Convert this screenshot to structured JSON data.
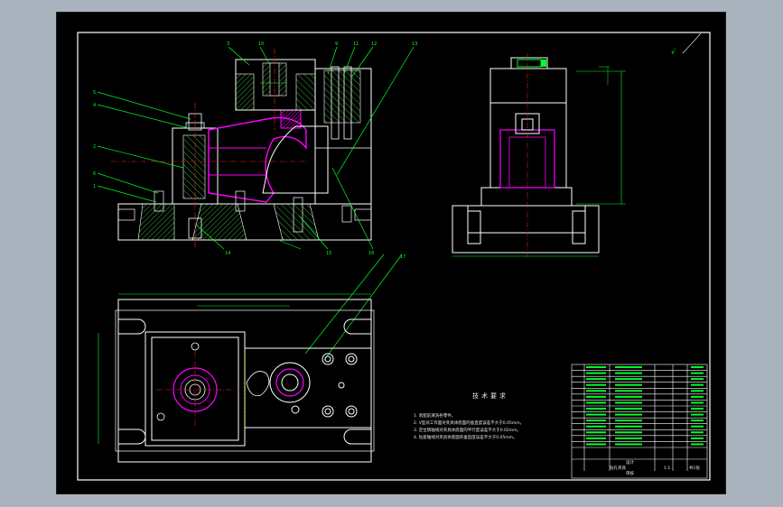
{
  "drawing": {
    "rough_mark": "√",
    "tech_title": "技术要求",
    "tech_notes": [
      "1. 装配前清洗各零件。",
      "2. V型块工作面对夹具体底面的垂直度误差不大于0.05mm。",
      "3. 定位销轴线对夹具体底面的平行度误差不大于0.02mm。",
      "4. 钻套轴线对夹具体底面的垂直度误差不大于0.05mm。"
    ],
    "parts_rows": 14,
    "title_block": {
      "name": "钻孔夹具",
      "scale": "1:1",
      "sheet": "共1张",
      "material": "",
      "drawn": "设计",
      "checked": "审核"
    }
  },
  "colors": {
    "background": "#000000",
    "frame": "#ffffff",
    "outline": "#ffffff",
    "leader": "#00ff2a",
    "part": "#ff00ff",
    "hatch": "#2f8f2f",
    "center": "#ff2020",
    "dimension": "#00ff2a"
  }
}
